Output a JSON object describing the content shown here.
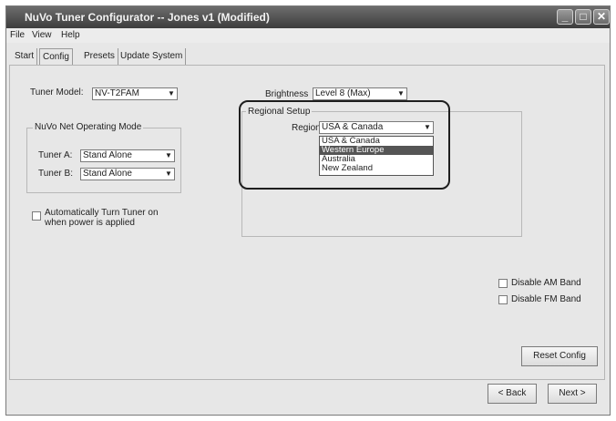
{
  "window": {
    "title": "NuVo Tuner Configurator -- Jones v1 (Modified)",
    "minimize_icon": "minimize-icon",
    "maximize_icon": "maximize-icon",
    "close_icon": "close-icon"
  },
  "menubar": {
    "items": [
      "File",
      "View",
      "Help"
    ]
  },
  "tabs": [
    {
      "label": "Start"
    },
    {
      "label": "Config"
    },
    {
      "label": "Presets"
    },
    {
      "label": "Update System"
    }
  ],
  "active_tab": "Config",
  "tuner": {
    "model_label": "Tuner Model:",
    "model_value": "NV-T2FAM"
  },
  "operating_mode": {
    "title": "NuVo Net Operating Mode",
    "tuner_a_label": "Tuner A:",
    "tuner_a_value": "Stand Alone",
    "tuner_b_label": "Tuner B:",
    "tuner_b_value": "Stand Alone"
  },
  "auto_power": {
    "line1": "Automatically Turn Tuner on",
    "line2": "when power is applied"
  },
  "brightness": {
    "label": "Brightness",
    "value": "Level 8 (Max)"
  },
  "regional_setup": {
    "title": "Regional Setup",
    "region_label": "Region:",
    "region_value": "USA & Canada",
    "options": [
      "USA & Canada",
      "Western Europe",
      "Australia",
      "New Zealand"
    ],
    "highlighted_option": "Western Europe"
  },
  "bands": {
    "disable_am": "Disable AM Band",
    "disable_fm": "Disable FM Band"
  },
  "buttons": {
    "reset": "Reset Config",
    "back": "< Back",
    "next": "Next >"
  }
}
